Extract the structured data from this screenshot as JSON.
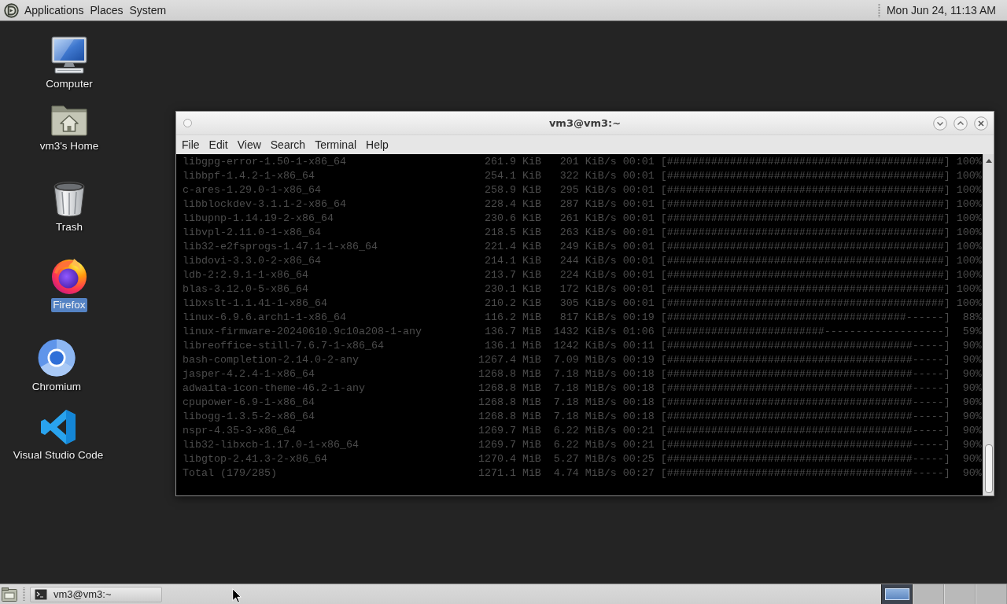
{
  "top_panel": {
    "menus": [
      "Applications",
      "Places",
      "System"
    ],
    "clock": "Mon Jun 24, 11:13 AM"
  },
  "desktop_icons": [
    {
      "label": "Computer",
      "kind": "computer",
      "selected": false
    },
    {
      "label": "vm3's Home",
      "kind": "home",
      "selected": false
    },
    {
      "label": "Trash",
      "kind": "trash",
      "selected": false
    },
    {
      "label": "Firefox",
      "kind": "firefox",
      "selected": true
    },
    {
      "label": "Chromium",
      "kind": "chromium",
      "selected": false
    },
    {
      "label": "Visual Studio Code",
      "kind": "vscode",
      "selected": false
    }
  ],
  "terminal_window": {
    "title": "vm3@vm3:~",
    "menu": [
      "File",
      "Edit",
      "View",
      "Search",
      "Terminal",
      "Help"
    ],
    "rows": [
      {
        "package": "libgpg-error-1.50-1-x86_64",
        "size": "261.9 KiB",
        "rate": "201 KiB/s",
        "eta": "00:01",
        "bar": "[############################################]",
        "percent": "100%"
      },
      {
        "package": "libbpf-1.4.2-1-x86_64",
        "size": "254.1 KiB",
        "rate": "322 KiB/s",
        "eta": "00:01",
        "bar": "[############################################]",
        "percent": "100%"
      },
      {
        "package": "c-ares-1.29.0-1-x86_64",
        "size": "258.9 KiB",
        "rate": "295 KiB/s",
        "eta": "00:01",
        "bar": "[############################################]",
        "percent": "100%"
      },
      {
        "package": "libblockdev-3.1.1-2-x86_64",
        "size": "228.4 KiB",
        "rate": "287 KiB/s",
        "eta": "00:01",
        "bar": "[############################################]",
        "percent": "100%"
      },
      {
        "package": "libupnp-1.14.19-2-x86_64",
        "size": "230.6 KiB",
        "rate": "261 KiB/s",
        "eta": "00:01",
        "bar": "[############################################]",
        "percent": "100%"
      },
      {
        "package": "libvpl-2.11.0-1-x86_64",
        "size": "218.5 KiB",
        "rate": "263 KiB/s",
        "eta": "00:01",
        "bar": "[############################################]",
        "percent": "100%"
      },
      {
        "package": "lib32-e2fsprogs-1.47.1-1-x86_64",
        "size": "221.4 KiB",
        "rate": "249 KiB/s",
        "eta": "00:01",
        "bar": "[############################################]",
        "percent": "100%"
      },
      {
        "package": "libdovi-3.3.0-2-x86_64",
        "size": "214.1 KiB",
        "rate": "244 KiB/s",
        "eta": "00:01",
        "bar": "[############################################]",
        "percent": "100%"
      },
      {
        "package": "ldb-2:2.9.1-1-x86_64",
        "size": "213.7 KiB",
        "rate": "224 KiB/s",
        "eta": "00:01",
        "bar": "[############################################]",
        "percent": "100%"
      },
      {
        "package": "blas-3.12.0-5-x86_64",
        "size": "230.1 KiB",
        "rate": "172 KiB/s",
        "eta": "00:01",
        "bar": "[############################################]",
        "percent": "100%"
      },
      {
        "package": "libxslt-1.1.41-1-x86_64",
        "size": "210.2 KiB",
        "rate": "305 KiB/s",
        "eta": "00:01",
        "bar": "[############################################]",
        "percent": "100%"
      },
      {
        "package": "linux-6.9.6.arch1-1-x86_64",
        "size": "116.2 MiB",
        "rate": "817 KiB/s",
        "eta": "00:19",
        "bar": "[######################################------]",
        "percent": "88%"
      },
      {
        "package": "linux-firmware-20240610.9c10a208-1-any",
        "size": "136.7 MiB",
        "rate": "1432 KiB/s",
        "eta": "01:06",
        "bar": "[#########################-------------------]",
        "percent": "59%"
      },
      {
        "package": "libreoffice-still-7.6.7-1-x86_64",
        "size": "136.1 MiB",
        "rate": "1242 KiB/s",
        "eta": "00:11",
        "bar": "[#######################################-----]",
        "percent": "90%"
      },
      {
        "package": "bash-completion-2.14.0-2-any",
        "size": "1267.4 MiB",
        "rate": "7.09 MiB/s",
        "eta": "00:19",
        "bar": "[#######################################-----]",
        "percent": "90%"
      },
      {
        "package": "jasper-4.2.4-1-x86_64",
        "size": "1268.8 MiB",
        "rate": "7.18 MiB/s",
        "eta": "00:18",
        "bar": "[#######################################-----]",
        "percent": "90%"
      },
      {
        "package": "adwaita-icon-theme-46.2-1-any",
        "size": "1268.8 MiB",
        "rate": "7.18 MiB/s",
        "eta": "00:18",
        "bar": "[#######################################-----]",
        "percent": "90%"
      },
      {
        "package": "cpupower-6.9-1-x86_64",
        "size": "1268.8 MiB",
        "rate": "7.18 MiB/s",
        "eta": "00:18",
        "bar": "[#######################################-----]",
        "percent": "90%"
      },
      {
        "package": "libogg-1.3.5-2-x86_64",
        "size": "1268.8 MiB",
        "rate": "7.18 MiB/s",
        "eta": "00:18",
        "bar": "[#######################################-----]",
        "percent": "90%"
      },
      {
        "package": "nspr-4.35-3-x86_64",
        "size": "1269.7 MiB",
        "rate": "6.22 MiB/s",
        "eta": "00:21",
        "bar": "[#######################################-----]",
        "percent": "90%"
      },
      {
        "package": "lib32-libxcb-1.17.0-1-x86_64",
        "size": "1269.7 MiB",
        "rate": "6.22 MiB/s",
        "eta": "00:21",
        "bar": "[#######################################-----]",
        "percent": "90%"
      },
      {
        "package": "libgtop-2.41.3-2-x86_64",
        "size": "1270.4 MiB",
        "rate": "5.27 MiB/s",
        "eta": "00:25",
        "bar": "[#######################################-----]",
        "percent": "90%"
      },
      {
        "package": "Total (179/285)",
        "size": "1271.1 MiB",
        "rate": "4.74 MiB/s",
        "eta": "00:27",
        "bar": "[#######################################-----]",
        "percent": "90%"
      }
    ]
  },
  "taskbar": {
    "tasks": [
      {
        "label": "vm3@vm3:~",
        "selected": false
      }
    ],
    "workspaces": [
      {
        "selected": true,
        "has_window": true
      },
      {
        "selected": false,
        "has_window": false
      },
      {
        "selected": false,
        "has_window": false
      },
      {
        "selected": false,
        "has_window": false
      }
    ]
  }
}
